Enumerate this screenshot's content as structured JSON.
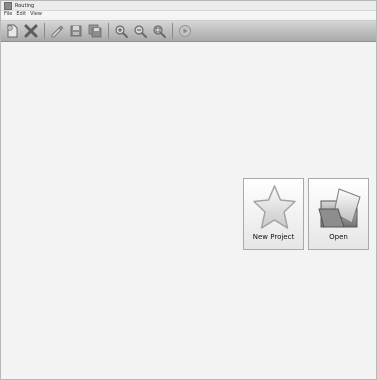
{
  "window": {
    "title": "Routing"
  },
  "menu": {
    "items": [
      "File",
      "Edit",
      "View"
    ]
  },
  "toolbar": {
    "buttons": [
      {
        "icon": "new-icon"
      },
      {
        "icon": "close-icon"
      },
      {
        "icon": "edit-icon"
      },
      {
        "icon": "save-icon"
      },
      {
        "icon": "save-all-icon"
      },
      {
        "icon": "zoom-in-icon"
      },
      {
        "icon": "zoom-out-icon"
      },
      {
        "icon": "zoom-fit-icon"
      },
      {
        "icon": "run-icon"
      }
    ]
  },
  "start": {
    "new_project_label": "New Project",
    "open_label": "Open",
    "new_project_icon": "star-icon",
    "open_icon": "folder-open-icon"
  }
}
